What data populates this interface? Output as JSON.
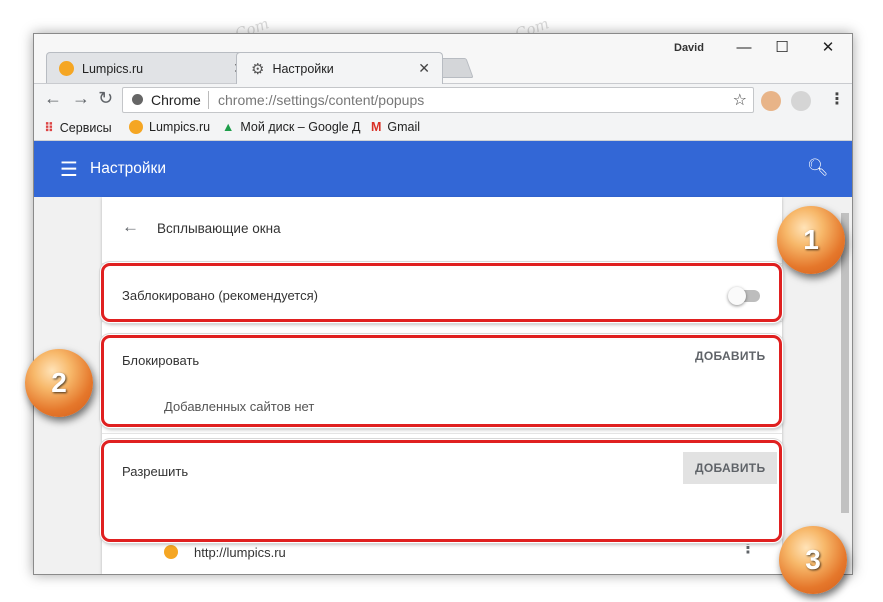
{
  "browser": {
    "user": "David",
    "tabs": [
      {
        "label": "Lumpics.ru",
        "close": "✕"
      },
      {
        "label": "Настройки",
        "close": "✕"
      }
    ],
    "window_controls": {
      "minimize": "—",
      "maximize": "☐",
      "close": "✕"
    },
    "omnibox": {
      "site_label": "Chrome",
      "url": "chrome://settings/content/popups"
    },
    "bookmarks": [
      {
        "label": "Сервисы"
      },
      {
        "label": "Lumpics.ru"
      },
      {
        "label": "Мой диск – Google Д"
      },
      {
        "label": "Gmail"
      }
    ]
  },
  "header": {
    "title": "Настройки"
  },
  "page": {
    "title": "Всплывающие окна",
    "blocked_toggle_label": "Заблокировано (рекомендуется)",
    "blocked_toggle_state": "off",
    "block_section": {
      "label": "Блокировать",
      "add_button": "ДОБАВИТЬ",
      "empty_text": "Добавленных сайтов нет"
    },
    "allow_section": {
      "label": "Разрешить",
      "add_button": "ДОБАВИТЬ",
      "sites": [
        {
          "url": "http://lumpics.ru"
        }
      ]
    }
  },
  "badges": [
    "1",
    "2",
    "3"
  ],
  "watermark": "Soringpcrepair.Com",
  "colors": {
    "accent": "#3367d6",
    "highlight": "#e02020",
    "badge": "#e5772b"
  }
}
